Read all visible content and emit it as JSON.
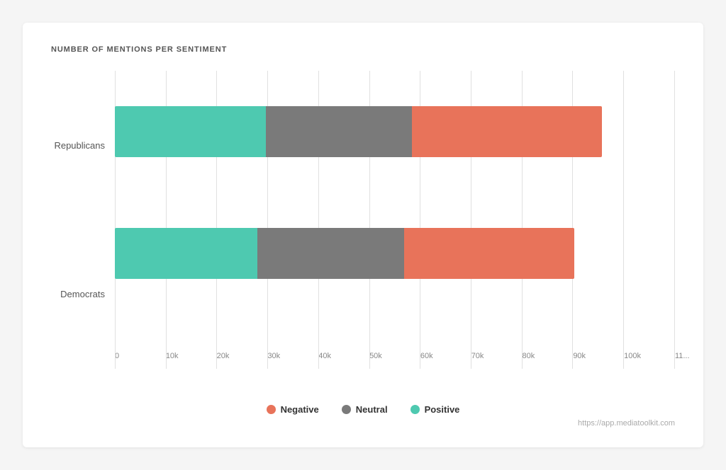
{
  "chart": {
    "title": "NUMBER OF MENTIONS PER SENTIMENT",
    "colors": {
      "negative": "#e8735a",
      "neutral": "#7a7a7a",
      "positive": "#4ec9b0"
    },
    "y_labels": [
      "Republicans",
      "Democrats"
    ],
    "x_ticks": [
      "0",
      "10k",
      "20k",
      "30k",
      "40k",
      "50k",
      "60k",
      "70k",
      "80k",
      "90k",
      "100k",
      "11..."
    ],
    "bars": [
      {
        "label": "Republicans",
        "segments": [
          {
            "type": "positive",
            "pct": 31
          },
          {
            "type": "neutral",
            "pct": 30
          },
          {
            "type": "negative",
            "pct": 36
          }
        ]
      },
      {
        "label": "Democrats",
        "segments": [
          {
            "type": "positive",
            "pct": 30
          },
          {
            "type": "neutral",
            "pct": 31
          },
          {
            "type": "negative",
            "pct": 30
          }
        ]
      }
    ],
    "legend": [
      {
        "key": "negative",
        "label": "Negative"
      },
      {
        "key": "neutral",
        "label": "Neutral"
      },
      {
        "key": "positive",
        "label": "Positive"
      }
    ],
    "watermark": "https://app.mediatoolkit.com"
  }
}
